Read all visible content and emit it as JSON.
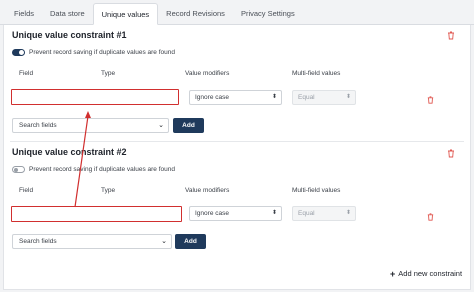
{
  "tabs": [
    {
      "label": "Fields",
      "active": false
    },
    {
      "label": "Data store",
      "active": false
    },
    {
      "label": "Unique values",
      "active": true
    },
    {
      "label": "Record Revisions",
      "active": false
    },
    {
      "label": "Privacy Settings",
      "active": false
    }
  ],
  "constraints": [
    {
      "title": "Unique value constraint #1",
      "prevent_toggle": {
        "label": "Prevent record saving if duplicate values are found",
        "on": true
      },
      "columns": {
        "field": "Field",
        "type": "Type",
        "modifiers": "Value modifiers",
        "multi": "Multi-field values"
      },
      "row": {
        "field_value": "",
        "type_value": "",
        "modifier": "Ignore case",
        "multi_value": "Equal"
      },
      "search_placeholder": "Search fields",
      "add_label": "Add"
    },
    {
      "title": "Unique value constraint #2",
      "prevent_toggle": {
        "label": "Prevent record saving if duplicate values are found",
        "on": false
      },
      "columns": {
        "field": "Field",
        "type": "Type",
        "modifiers": "Value modifiers",
        "multi": "Multi-field values"
      },
      "row": {
        "field_value": "",
        "type_value": "",
        "modifier": "Ignore case",
        "multi_value": "Equal"
      },
      "search_placeholder": "Search fields",
      "add_label": "Add"
    }
  ],
  "add_constraint_label": "Add new constraint",
  "colors": {
    "primary": "#1f3a5c",
    "highlight": "#d12f2f",
    "danger": "#e0564f"
  }
}
